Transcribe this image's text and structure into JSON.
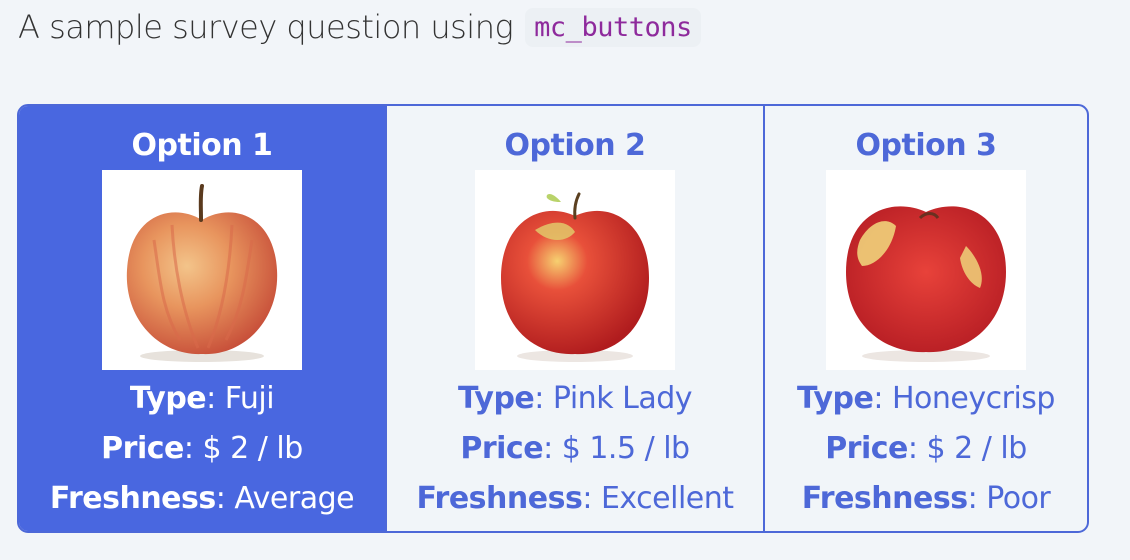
{
  "question": {
    "text": "A sample survey question using",
    "code": "mc_buttons"
  },
  "options": [
    {
      "title": "Option 1",
      "image_icon": "fuji-apple-image",
      "selected": true,
      "type_label": "Type",
      "type_value": ": Fuji",
      "price_label": "Price",
      "price_value": ": $ 2 / lb",
      "freshness_label": "Freshness",
      "freshness_value": ": Average"
    },
    {
      "title": "Option 2",
      "image_icon": "pink-lady-apple-image",
      "selected": false,
      "type_label": "Type",
      "type_value": ": Pink Lady",
      "price_label": "Price",
      "price_value": ": $ 1.5 / lb",
      "freshness_label": "Freshness",
      "freshness_value": ": Excellent"
    },
    {
      "title": "Option 3",
      "image_icon": "honeycrisp-apple-image",
      "selected": false,
      "type_label": "Type",
      "type_value": ": Honeycrisp",
      "price_label": "Price",
      "price_value": ": $ 2 / lb",
      "freshness_label": "Freshness",
      "freshness_value": ": Poor"
    }
  ],
  "colors": {
    "accent": "#4967e0",
    "selected_text": "#ffffff",
    "code_text": "#8e2a9c",
    "background": "#f2f5f9"
  }
}
